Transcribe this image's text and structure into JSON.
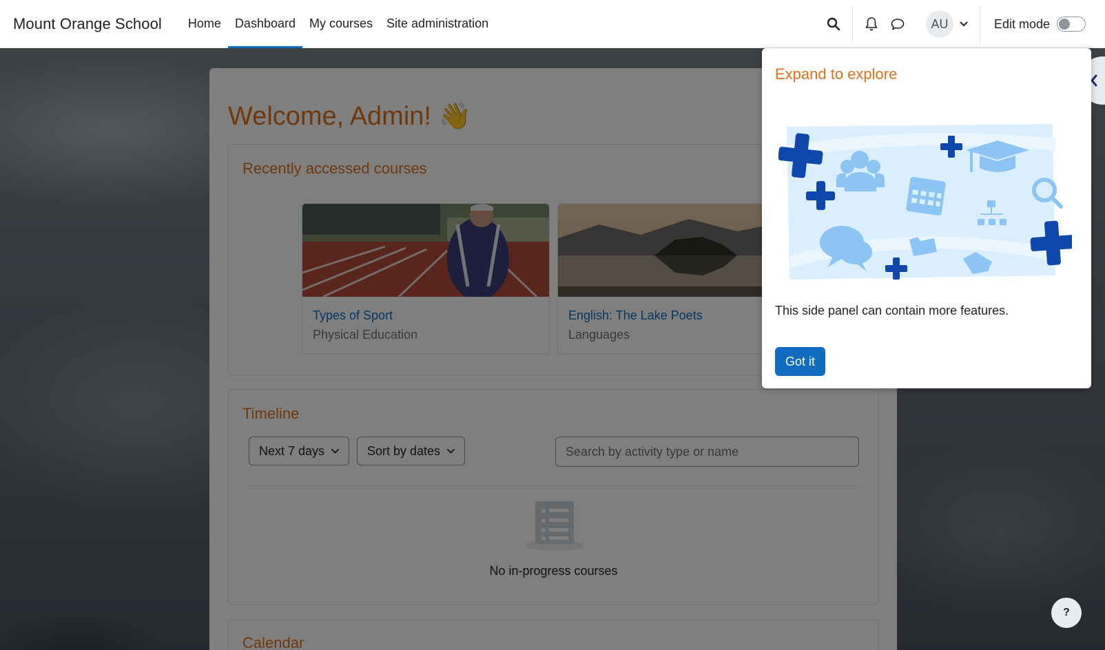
{
  "navbar": {
    "brand": "Mount Orange School",
    "items": [
      {
        "label": "Home",
        "active": false
      },
      {
        "label": "Dashboard",
        "active": true
      },
      {
        "label": "My courses",
        "active": false
      },
      {
        "label": "Site administration",
        "active": false
      }
    ],
    "avatar_initials": "AU",
    "edit_mode_label": "Edit mode",
    "edit_mode_on": false,
    "icons": [
      "search-icon",
      "bell-icon",
      "chat-bubble-icon",
      "chevron-down-icon"
    ]
  },
  "main": {
    "welcome": "Welcome, Admin! 👋",
    "recent": {
      "title": "Recently accessed courses",
      "courses": [
        {
          "name": "Types of Sport",
          "category": "Physical Education"
        },
        {
          "name": "English: The Lake Poets",
          "category": "Languages"
        }
      ]
    },
    "timeline": {
      "title": "Timeline",
      "filter": "Next 7 days",
      "sort": "Sort by dates",
      "search_placeholder": "Search by activity type or name",
      "empty_text": "No in-progress courses"
    },
    "calendar": {
      "title": "Calendar"
    }
  },
  "popover": {
    "title": "Expand to explore",
    "text": "This side panel can contain more features.",
    "button": "Got it"
  },
  "help_label": "?",
  "colors": {
    "accent": "#e0701a",
    "primary": "#0f6cbf",
    "illustration_light": "#dbeefd",
    "illustration_dark": "#0f47ad"
  }
}
